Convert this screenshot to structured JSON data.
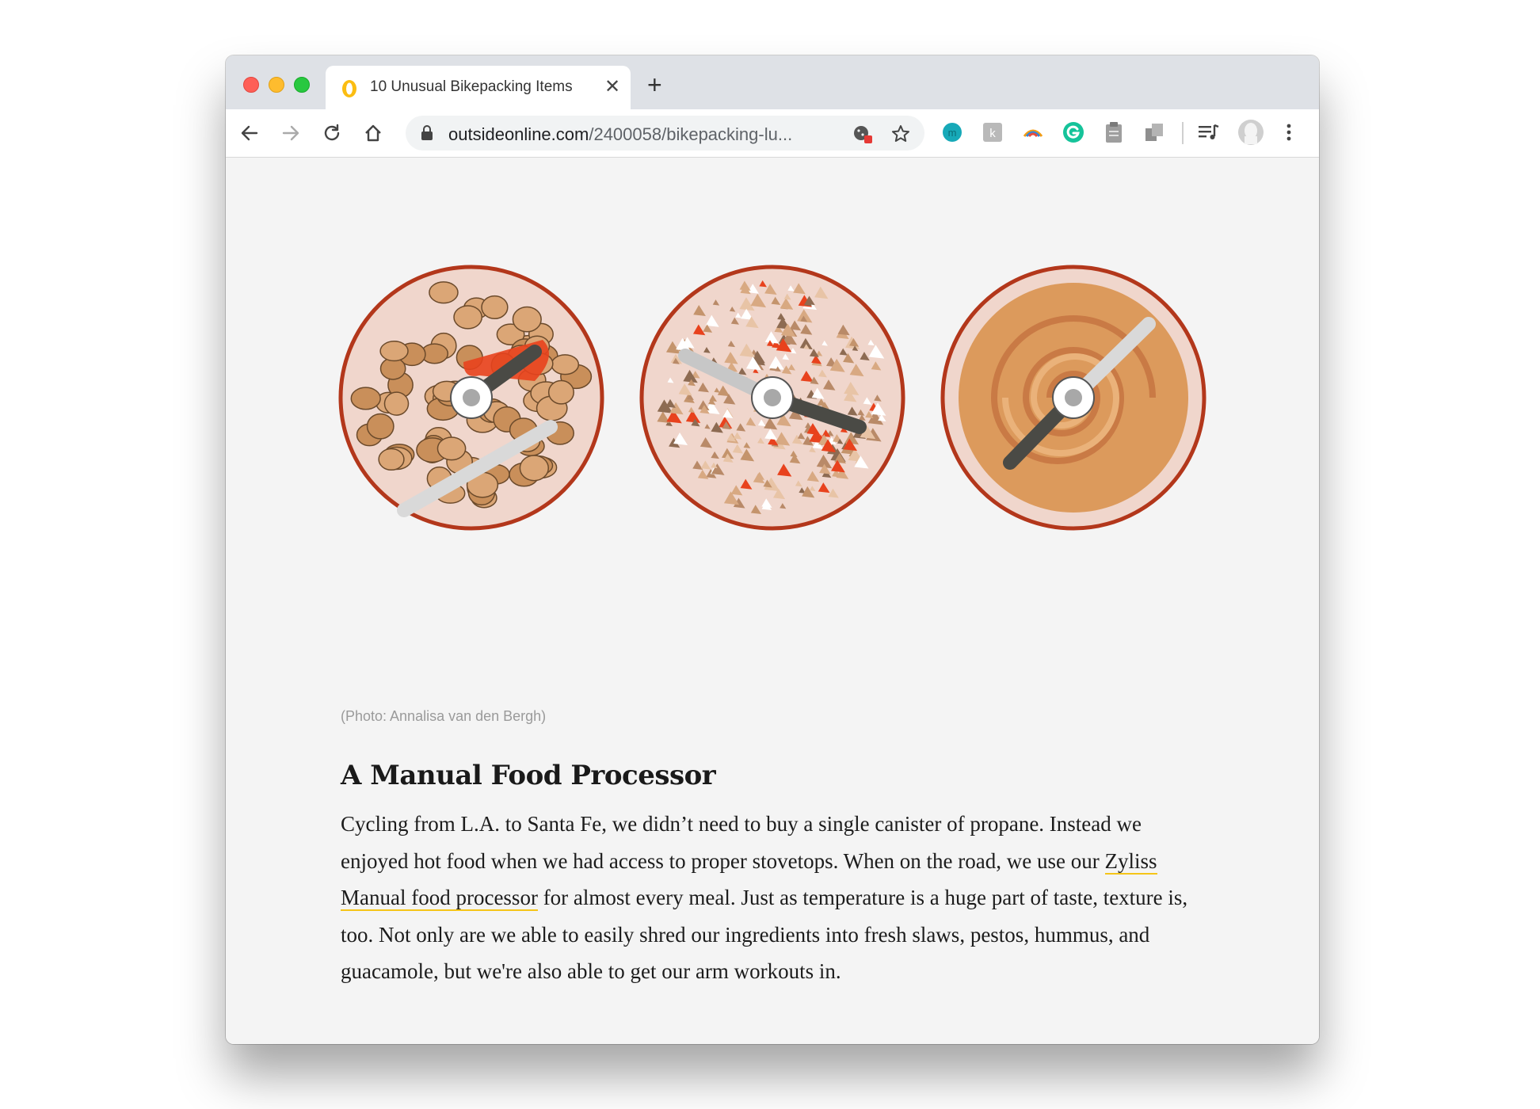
{
  "browser": {
    "tab": {
      "title": "10 Unusual Bikepacking Items",
      "close": "✕",
      "favicon": "opera-favicon-icon"
    },
    "new_tab": "+",
    "url": {
      "host": "outsideonline.com",
      "path": "/2400058/bikepacking-lu..."
    },
    "extensions": [
      "cookie-blocker-icon",
      "star-icon",
      "ext-teal-m-icon",
      "ext-gray-k-icon",
      "ext-rainbow-icon",
      "grammarly-icon",
      "ext-notes-icon",
      "ext-copies-icon",
      "media-queue-icon",
      "profile-avatar-icon",
      "menu-dots-icon"
    ]
  },
  "article": {
    "photo_credit": "(Photo: Annalisa van den Bergh)",
    "heading": "A Manual Food Processor",
    "paragraph_before_link": "Cycling from L.A. to Santa Fe, we didn’t need to buy a single canister of propane. Instead we enjoyed hot food when we had access to proper stovetops. When on the road, we use our ",
    "link_text": "Zyliss Manual food processor",
    "paragraph_after_link": " for almost every meal. Just as temperature is a huge part of taste, texture is, too. Not only are we able to easily shred our ingredients into fresh slaws, pestos, hummus, and guacamole, but we're also able to get our arm workouts in."
  },
  "colors": {
    "ring": "#b3371b",
    "chickpea": "#c98f5a",
    "pepper": "#e8421d",
    "hummus": "#dc9a5c",
    "blade_dark": "#4a4a45",
    "blade_light": "#cfcfcf"
  }
}
